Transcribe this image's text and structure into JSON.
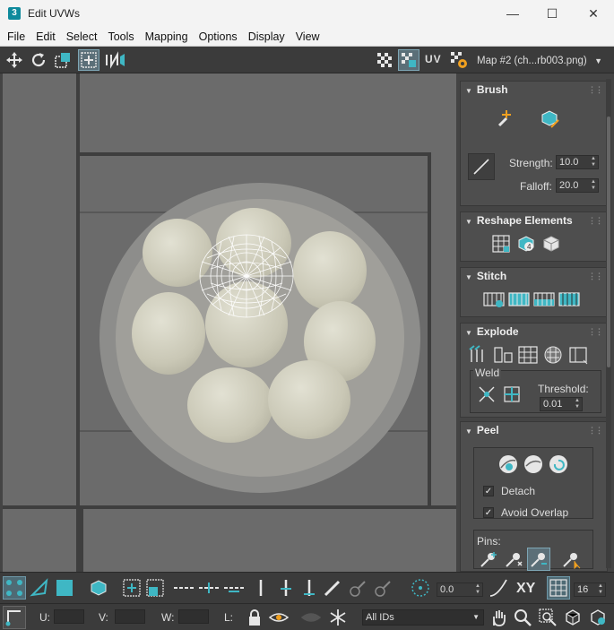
{
  "window": {
    "app_icon": "3",
    "title": "Edit UVWs",
    "minimize": "—",
    "maximize": "☐",
    "close": "✕"
  },
  "menu": [
    "File",
    "Edit",
    "Select",
    "Tools",
    "Mapping",
    "Options",
    "Display",
    "View"
  ],
  "toolbar": {
    "uv_label": "UV",
    "map_select": "Map #2 (ch...rb003.png)"
  },
  "panel": {
    "brush": {
      "title": "Brush",
      "strength_label": "Strength:",
      "strength_value": "10.0",
      "falloff_label": "Falloff:",
      "falloff_value": "20.0"
    },
    "reshape": {
      "title": "Reshape Elements"
    },
    "stitch": {
      "title": "Stitch"
    },
    "explode": {
      "title": "Explode",
      "weld_label": "Weld",
      "threshold_label": "Threshold:",
      "threshold_value": "0.01"
    },
    "peel": {
      "title": "Peel",
      "detach_label": "Detach",
      "detach_checked": true,
      "avoid_overlap_label": "Avoid Overlap",
      "avoid_overlap_checked": true,
      "pins_label": "Pins:"
    }
  },
  "bottom": {
    "rotate_value": "0.0",
    "xy_label": "XY",
    "grid_value": "16",
    "u_label": "U:",
    "u_value": "",
    "v_label": "V:",
    "v_value": "",
    "w_label": "W:",
    "w_value": "",
    "l_label": "L:",
    "ids_select": "All IDs"
  },
  "colors": {
    "accent_teal": "#3fb7c4",
    "panel_bg": "#444444",
    "viewport_bg": "#6b6b6b"
  }
}
